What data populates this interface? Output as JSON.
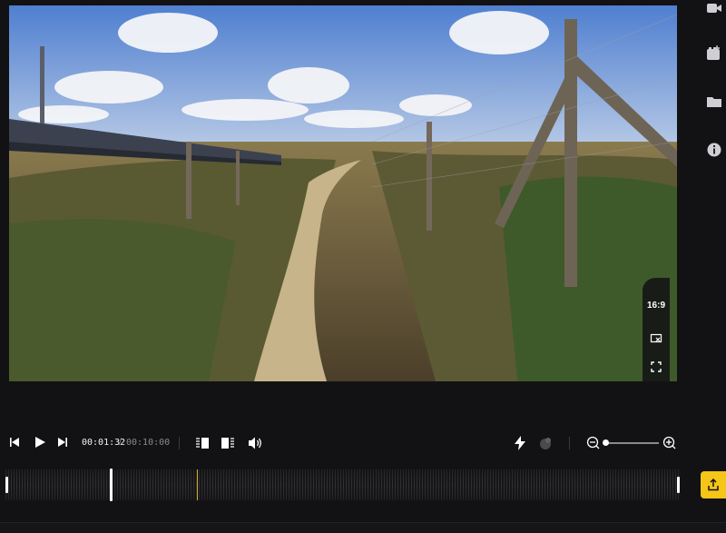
{
  "preview": {
    "aspect_ratio_label": "16:9",
    "overlay_icons": [
      "crop-icon",
      "fullscreen-icon"
    ]
  },
  "sidebar": {
    "icons": [
      "video-camera-icon",
      "add-clip-icon",
      "folder-icon",
      "info-icon"
    ]
  },
  "playback": {
    "current_time": "00:01:32",
    "separator": "/",
    "total_time": "00:10:00",
    "zoom_level": 0.0,
    "playhead_position": 0.148
  },
  "colors": {
    "accent": "#f5c518",
    "background": "#121214",
    "marker": "#d4a72c"
  }
}
